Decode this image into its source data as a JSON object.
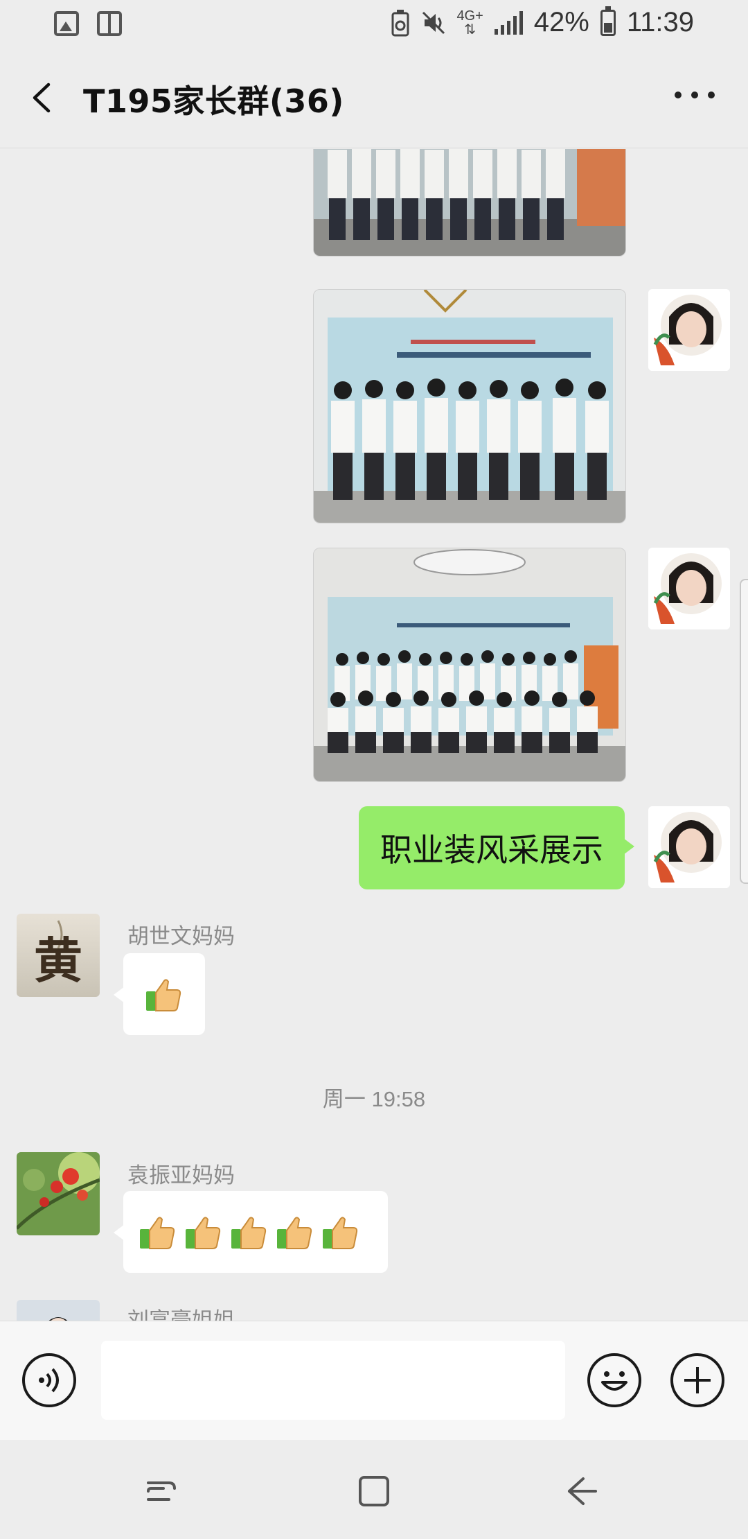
{
  "status_bar": {
    "network": "4G+",
    "battery": "42%",
    "time": "11:39",
    "icons": [
      "gallery-icon",
      "checklist-icon",
      "recycle-icon",
      "mute-icon",
      "signal-icon",
      "battery-icon"
    ]
  },
  "header": {
    "title": "T195家长群(36)",
    "back_icon": "chevron-left-icon",
    "more_icon": "more-dots-icon"
  },
  "messages": [
    {
      "type": "image",
      "from": "me",
      "caption": "",
      "partial": true
    },
    {
      "type": "image",
      "from": "me",
      "caption": ""
    },
    {
      "type": "image",
      "from": "me",
      "caption": ""
    },
    {
      "type": "text",
      "from": "me",
      "text": "职业装风采展示"
    },
    {
      "type": "emoji",
      "from": "胡世文妈妈",
      "sender": "胡世文妈妈",
      "count": 1,
      "emoji": "thumbs-up",
      "avatar_char": "黄"
    },
    {
      "type": "time",
      "text": "周一 19:58"
    },
    {
      "type": "emoji",
      "from": "袁振亚妈妈",
      "sender": "袁振亚妈妈",
      "count": 5,
      "emoji": "thumbs-up"
    },
    {
      "type": "partial",
      "sender": "刘富豪姐姐"
    }
  ],
  "input_bar": {
    "voice_icon": "voice-icon",
    "emoji_icon": "smiley-icon",
    "plus_icon": "plus-icon",
    "value": ""
  },
  "nav_bar": [
    "recent-apps-icon",
    "home-icon",
    "back-arrow-icon"
  ],
  "colors": {
    "background": "#ededed",
    "my_bubble": "#95ec69",
    "other_bubble": "#ffffff",
    "meta_text": "#8a8a8a"
  }
}
